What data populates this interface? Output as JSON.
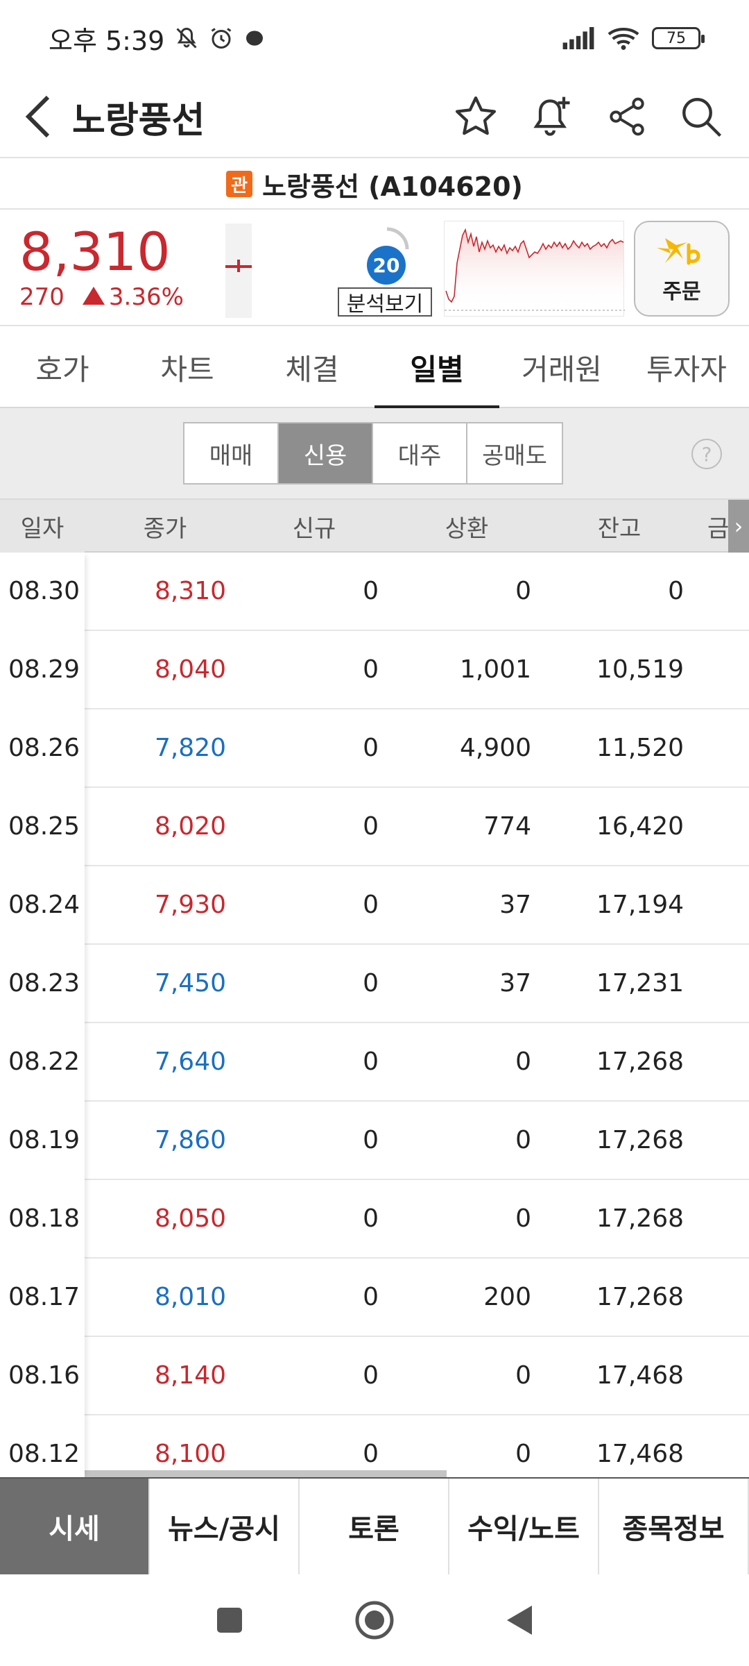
{
  "status_bar": {
    "time": "오후 5:39",
    "battery": "75"
  },
  "header": {
    "title": "노랑풍선"
  },
  "stock": {
    "badge": "관",
    "name": "노랑풍선 (A104620)"
  },
  "quote": {
    "price": "8,310",
    "change": "270",
    "change_pct": "3.36%",
    "analysis_score": "20",
    "analysis_label": "분석보기",
    "order_label": "주문"
  },
  "main_tabs": [
    "호가",
    "차트",
    "체결",
    "일별",
    "거래원",
    "투자자"
  ],
  "active_main_tab": "일별",
  "filter_tabs": [
    "매매",
    "신용",
    "대주",
    "공매도"
  ],
  "active_filter_tab": "신용",
  "help": "?",
  "table": {
    "columns": [
      "일자",
      "종가",
      "신규",
      "상환",
      "잔고",
      "금"
    ],
    "rows": [
      {
        "date": "08.30",
        "close": "8,310",
        "dir": "up",
        "new": "0",
        "repay": "0",
        "balance": "0"
      },
      {
        "date": "08.29",
        "close": "8,040",
        "dir": "up",
        "new": "0",
        "repay": "1,001",
        "balance": "10,519"
      },
      {
        "date": "08.26",
        "close": "7,820",
        "dir": "down",
        "new": "0",
        "repay": "4,900",
        "balance": "11,520"
      },
      {
        "date": "08.25",
        "close": "8,020",
        "dir": "up",
        "new": "0",
        "repay": "774",
        "balance": "16,420"
      },
      {
        "date": "08.24",
        "close": "7,930",
        "dir": "up",
        "new": "0",
        "repay": "37",
        "balance": "17,194"
      },
      {
        "date": "08.23",
        "close": "7,450",
        "dir": "down",
        "new": "0",
        "repay": "37",
        "balance": "17,231"
      },
      {
        "date": "08.22",
        "close": "7,640",
        "dir": "down",
        "new": "0",
        "repay": "0",
        "balance": "17,268"
      },
      {
        "date": "08.19",
        "close": "7,860",
        "dir": "down",
        "new": "0",
        "repay": "0",
        "balance": "17,268"
      },
      {
        "date": "08.18",
        "close": "8,050",
        "dir": "up",
        "new": "0",
        "repay": "0",
        "balance": "17,268"
      },
      {
        "date": "08.17",
        "close": "8,010",
        "dir": "down",
        "new": "0",
        "repay": "200",
        "balance": "17,268"
      },
      {
        "date": "08.16",
        "close": "8,140",
        "dir": "up",
        "new": "0",
        "repay": "0",
        "balance": "17,468"
      },
      {
        "date": "08.12",
        "close": "8,100",
        "dir": "up",
        "new": "0",
        "repay": "0",
        "balance": "17,468"
      }
    ]
  },
  "bottom_tabs": [
    "시세",
    "뉴스/공시",
    "토론",
    "수익/노트",
    "종목정보"
  ],
  "active_bottom_tab": "시세",
  "colors": {
    "up": "#c8282e",
    "down": "#1a6fc2",
    "badge": "#f06a1a",
    "score": "#1a73c9",
    "kb_yellow": "#f5b800"
  },
  "icons": [
    "back-arrow-icon",
    "star-icon",
    "bell-add-icon",
    "share-icon",
    "search-icon",
    "kb-logo-icon",
    "help-icon",
    "chevron-right-icon"
  ]
}
